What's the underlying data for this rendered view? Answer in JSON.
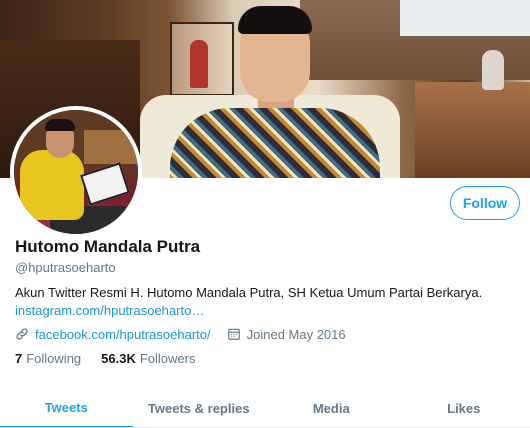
{
  "profile": {
    "follow_label": "Follow",
    "name": "Hutomo Mandala Putra",
    "handle": "@hputrasoeharto",
    "bio_text": "Akun Twitter Resmi H. Hutomo Mandala Putra, SH Ketua Umum Partai Berkarya.",
    "bio_link": "instagram.com/hputrasoeharto",
    "bio_link_suffix": "…",
    "website": "facebook.com/hputrasoeharto/",
    "joined": "Joined May 2016",
    "following_count": "7",
    "following_label": "Following",
    "followers_count": "56.3K",
    "followers_label": "Followers"
  },
  "icons": {
    "website": "link-icon",
    "joined": "calendar-icon"
  },
  "tabs": [
    {
      "label": "Tweets",
      "active": true
    },
    {
      "label": "Tweets & replies",
      "active": false
    },
    {
      "label": "Media",
      "active": false
    },
    {
      "label": "Likes",
      "active": false
    }
  ],
  "colors": {
    "accent": "#1da1f2",
    "link": "#1b95e0",
    "secondary_text": "#657786",
    "primary_text": "#14171a"
  }
}
